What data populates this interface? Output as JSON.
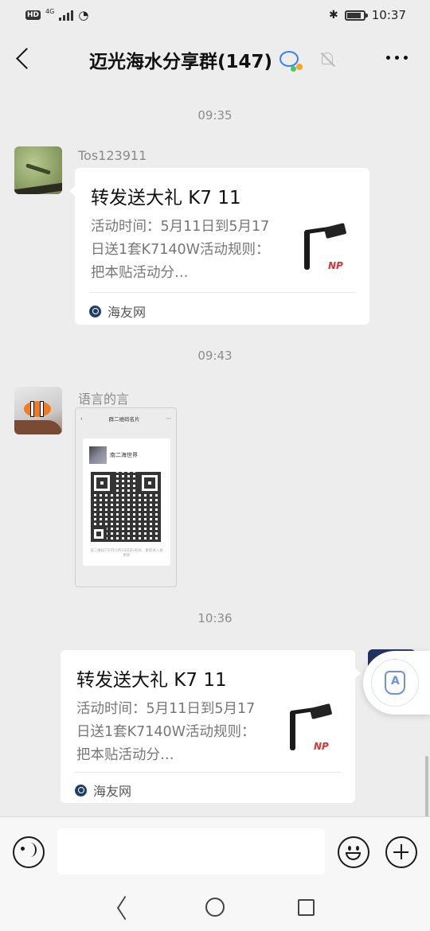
{
  "status_bar": {
    "hd_badge": "HD",
    "network": "4G",
    "time": "10:37"
  },
  "header": {
    "title": "迈光海水分享群(147)"
  },
  "messages": [
    {
      "timestamp": "09:35",
      "sender": "Tos123911",
      "card": {
        "title": "转发送大礼 K7 11",
        "description": "活动时间：5月11日到5月17日送1套K7140W活动规则：把本贴活动分…",
        "thumb_logo": "NP",
        "source": "海友网"
      }
    },
    {
      "timestamp": "09:43",
      "sender": "语言的言",
      "image": {
        "top_title": "群二维码名片",
        "group_name": "南二海世界",
        "hint": "该二维码7天内(5月18日前)有效，重新进入将更新"
      }
    },
    {
      "timestamp": "10:36",
      "card": {
        "title": "转发送大礼 K7 11",
        "description": "活动时间：5月11日到5月17日送1套K7140W活动规则：把本贴活动分…",
        "thumb_logo": "NP",
        "source": "海友网"
      }
    }
  ]
}
